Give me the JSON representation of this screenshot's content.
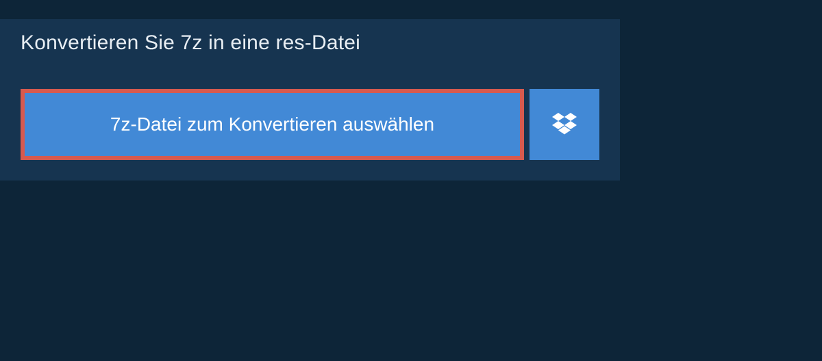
{
  "header": {
    "title": "Konvertieren Sie 7z in eine res-Datei"
  },
  "actions": {
    "select_file_label": "7z-Datei zum Konvertieren auswählen"
  }
}
